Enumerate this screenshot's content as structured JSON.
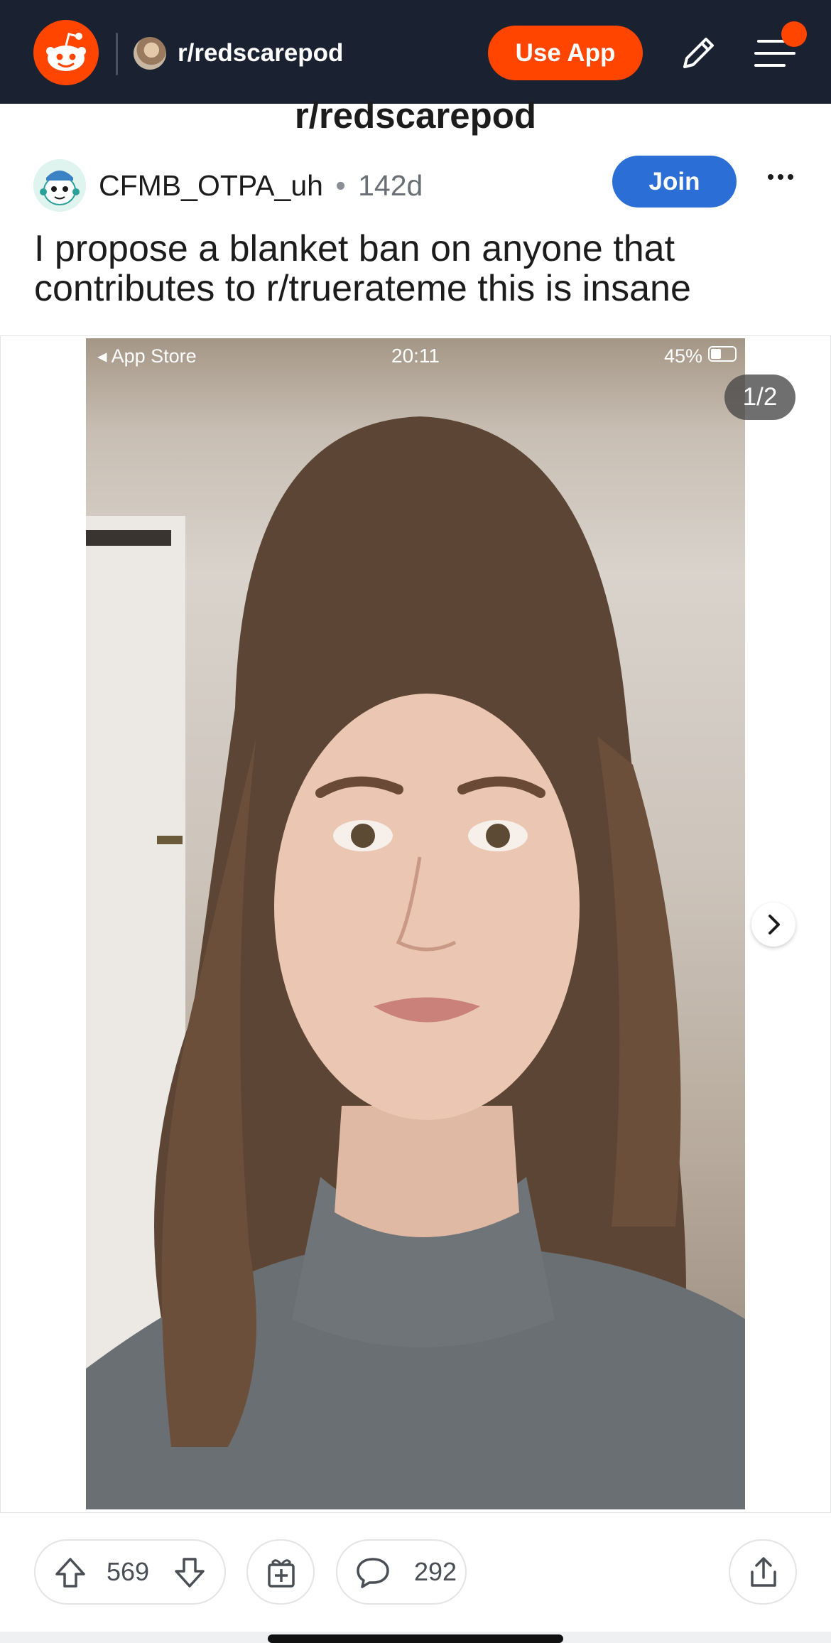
{
  "nav": {
    "subreddit": "r/redscarepod",
    "use_app_label": "Use App"
  },
  "post": {
    "sticky_title": "r/redscarepod",
    "author": "CFMB_OTPA_uh",
    "separator": "•",
    "age": "142d",
    "join_label": "Join",
    "title": "I propose a blanket ban on anyone that contributes to r/truerateme this is insane"
  },
  "media": {
    "status_left": "◂ App Store",
    "status_time": "20:11",
    "status_right": "45%",
    "counter": "1/2"
  },
  "actions": {
    "upvotes": "569",
    "comments": "292"
  },
  "colors": {
    "nav_bg": "#1a2130",
    "brand": "#ff4500",
    "join_blue": "#2b6fd6"
  },
  "icons": [
    "reddit-logo-icon",
    "pencil-icon",
    "hamburger-menu-icon",
    "more-options-icon",
    "chevron-right-icon",
    "upvote-icon",
    "downvote-icon",
    "award-icon",
    "comment-icon",
    "share-icon"
  ]
}
